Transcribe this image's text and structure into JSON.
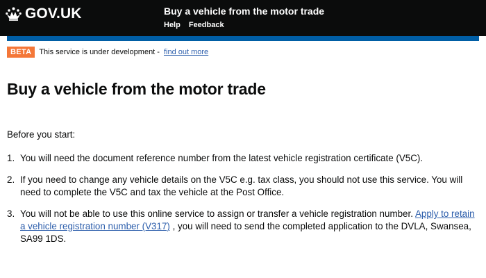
{
  "header": {
    "logo_text": "GOV.UK",
    "service_name": "Buy a vehicle from the motor trade",
    "nav": [
      "Help",
      "Feedback"
    ]
  },
  "beta_banner": {
    "tag": "BETA",
    "text": "This service is under development -",
    "link": "find out more"
  },
  "page": {
    "title": "Buy a vehicle from the motor trade",
    "intro": "Before you start:"
  },
  "steps": [
    {
      "number": "1.",
      "text": "You will need the document reference number from the latest vehicle registration certificate (V5C)."
    },
    {
      "number": "2.",
      "text": "If you need to change any vehicle details on the V5C e.g. tax class, you should not use this service. You will need to complete the V5C and tax the vehicle at the Post Office."
    },
    {
      "number": "3.",
      "text_before": "You will not be able to use this online service to assign or transfer a vehicle registration number.",
      "link": "Apply to retain a vehicle registration number (V317)",
      "text_after": ", you will need to send the completed application to the DVLA, Swansea, SA99 1DS."
    }
  ],
  "colors": {
    "header_bg": "#0b0c0c",
    "blue_bar": "#005ea5",
    "beta_tag": "#f47738",
    "link": "#2b5dab"
  }
}
